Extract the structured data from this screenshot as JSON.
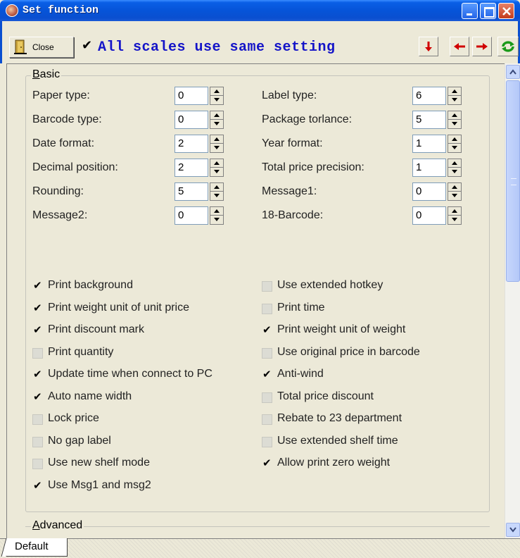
{
  "window": {
    "title": "Set function"
  },
  "toolbar": {
    "close_label": "Close",
    "same_setting_label": "All scales use same setting",
    "same_setting_checked": true
  },
  "basic": {
    "title_first": "B",
    "title_rest": "asic",
    "left_fields": [
      {
        "label": "Paper type:",
        "value": "0"
      },
      {
        "label": "Barcode type:",
        "value": "0"
      },
      {
        "label": "Date format:",
        "value": "2"
      },
      {
        "label": "Decimal position:",
        "value": "2"
      },
      {
        "label": "Rounding:",
        "value": "5"
      },
      {
        "label": "Message2:",
        "value": "0"
      }
    ],
    "right_fields": [
      {
        "label": "Label type:",
        "value": "6"
      },
      {
        "label": "Package torlance:",
        "value": "5"
      },
      {
        "label": "Year format:",
        "value": "1"
      },
      {
        "label": "Total price precision:",
        "value": "1"
      },
      {
        "label": "Message1:",
        "value": "0"
      },
      {
        "label": "18-Barcode:",
        "value": "0"
      }
    ],
    "left_checks": [
      {
        "label": "Print background",
        "checked": true
      },
      {
        "label": "Print weight unit of unit price",
        "checked": true
      },
      {
        "label": "Print discount mark",
        "checked": true
      },
      {
        "label": "Print quantity",
        "checked": false
      },
      {
        "label": "Update time when connect to PC",
        "checked": true
      },
      {
        "label": "Auto name width",
        "checked": true
      },
      {
        "label": "Lock price",
        "checked": false
      },
      {
        "label": "No gap label",
        "checked": false
      },
      {
        "label": "Use new shelf mode",
        "checked": false
      },
      {
        "label": "Use Msg1 and  msg2",
        "checked": true
      }
    ],
    "right_checks": [
      {
        "label": "Use extended hotkey",
        "checked": false
      },
      {
        "label": "Print time",
        "checked": false
      },
      {
        "label": "Print weight unit of weight",
        "checked": true
      },
      {
        "label": "Use original price in barcode",
        "checked": false
      },
      {
        "label": "Anti-wind",
        "checked": true
      },
      {
        "label": "Total price discount",
        "checked": false
      },
      {
        "label": "Rebate to 23 department",
        "checked": false
      },
      {
        "label": "Use extended shelf time",
        "checked": false
      },
      {
        "label": "Allow print zero weight",
        "checked": true
      }
    ]
  },
  "advanced": {
    "title_first": "A",
    "title_rest": "dvanced"
  },
  "tabs": [
    {
      "label": "Default",
      "active": true
    }
  ],
  "colors": {
    "titlebar": "#0a4fd0",
    "same_setting_text": "#1414c8",
    "nav_arrow": "#d00000",
    "refresh": "#1a9a1a"
  }
}
